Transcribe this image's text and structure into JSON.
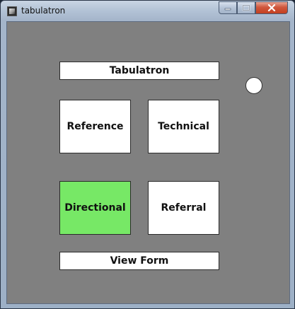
{
  "window": {
    "title": "tabulatron",
    "icon": "app-icon",
    "controls": {
      "minimize": "minimize-icon",
      "maximize": "maximize-icon",
      "close": "close-icon"
    }
  },
  "main": {
    "title_label": "Tabulatron",
    "buttons": {
      "reference": "Reference",
      "technical": "Technical",
      "directional": "Directional",
      "referral": "Referral"
    },
    "view_form_label": "View Form",
    "status_indicator": "circle-indicator"
  },
  "colors": {
    "client_background": "#808080",
    "button_background": "#ffffff",
    "selected_button": "#77e866",
    "close_button": "#c3401f"
  }
}
